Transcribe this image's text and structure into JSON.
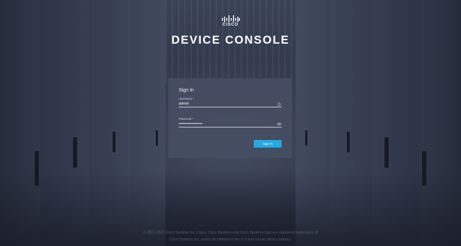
{
  "brand": {
    "logo_text": "CISCO",
    "logo_icon": "cisco-bridge-bars-icon"
  },
  "page_title": "DEVICE CONSOLE",
  "signin": {
    "title": "Sign In",
    "username": {
      "label": "Username *",
      "value": "admin",
      "icon": "info-circle-icon"
    },
    "password": {
      "label": "Password *",
      "value": "••••••••••••••••••",
      "icon": "eye-icon"
    },
    "button_label": "Sign In",
    "button_color": "#28a8e0"
  },
  "footer": {
    "line1": "© 2017-2021 Cisco Systems Inc. Cisco, Cisco Systems and Cisco Systems logo are registered trademarks of",
    "line2": "Cisco Systems Inc. and/or its affiliates in the U.S and certain other countries."
  }
}
